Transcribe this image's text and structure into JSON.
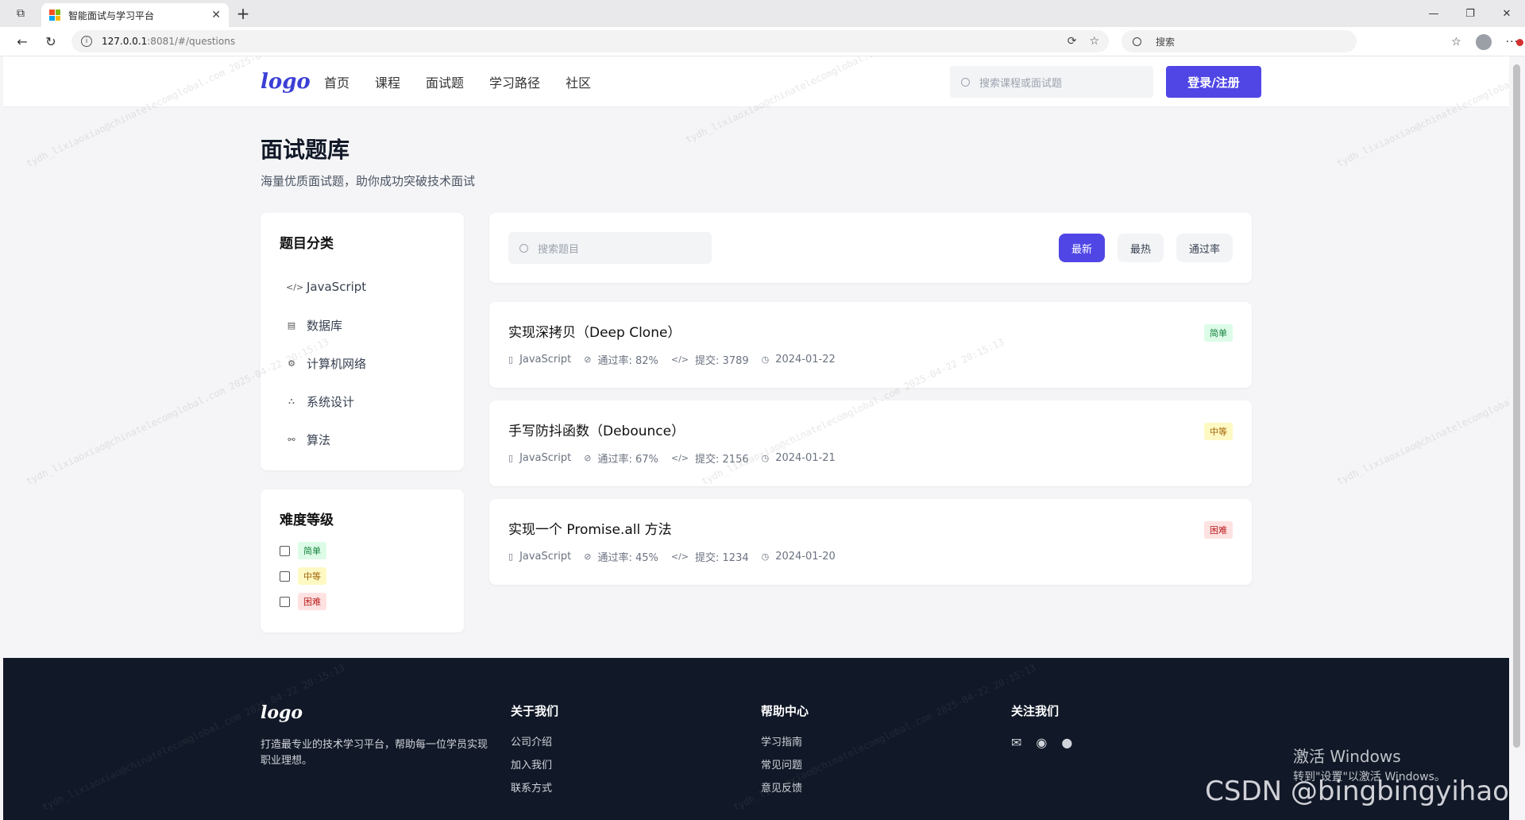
{
  "browser": {
    "tab_title": "智能面试与学习平台",
    "url_host": "127.0.0.1",
    "url_rest": ":8081/#/questions",
    "search_placeholder": "搜索"
  },
  "header": {
    "logo": "logo",
    "nav": [
      "首页",
      "课程",
      "面试题",
      "学习路径",
      "社区"
    ],
    "search_placeholder": "搜索课程或面试题",
    "login_label": "登录/注册"
  },
  "page": {
    "title": "面试题库",
    "subtitle": "海量优质面试题，助你成功突破技术面试"
  },
  "categories": {
    "title": "题目分类",
    "items": [
      {
        "label": "JavaScript",
        "icon": "code-icon"
      },
      {
        "label": "数据库",
        "icon": "database-icon"
      },
      {
        "label": "计算机网络",
        "icon": "network-icon"
      },
      {
        "label": "系统设计",
        "icon": "sitemap-icon"
      },
      {
        "label": "算法",
        "icon": "algorithm-icon"
      }
    ]
  },
  "difficulty": {
    "title": "难度等级",
    "levels": [
      "简单",
      "中等",
      "困难"
    ]
  },
  "filter": {
    "search_placeholder": "搜索题目",
    "sorts": [
      "最新",
      "最热",
      "通过率"
    ],
    "active_sort": "最新"
  },
  "questions": [
    {
      "title": "实现深拷贝（Deep Clone）",
      "category": "JavaScript",
      "pass_rate": "通过率: 82%",
      "submissions": "提交: 3789",
      "date": "2024-01-22",
      "difficulty": "简单"
    },
    {
      "title": "手写防抖函数（Debounce）",
      "category": "JavaScript",
      "pass_rate": "通过率: 67%",
      "submissions": "提交: 2156",
      "date": "2024-01-21",
      "difficulty": "中等"
    },
    {
      "title": "实现一个 Promise.all 方法",
      "category": "JavaScript",
      "pass_rate": "通过率: 45%",
      "submissions": "提交: 1234",
      "date": "2024-01-20",
      "difficulty": "困难"
    }
  ],
  "footer": {
    "logo": "logo",
    "description": "打造最专业的技术学习平台，帮助每一位学员实现职业理想。",
    "about": {
      "title": "关于我们",
      "links": [
        "公司介绍",
        "加入我们",
        "联系方式"
      ]
    },
    "help": {
      "title": "帮助中心",
      "links": [
        "学习指南",
        "常见问题",
        "意见反馈"
      ]
    },
    "follow": {
      "title": "关注我们",
      "icons": [
        "wechat-icon",
        "weibo-icon",
        "github-icon"
      ]
    }
  },
  "overlay": {
    "activate_title": "激活 Windows",
    "activate_sub": "转到\"设置\"以激活 Windows。",
    "csdn": "CSDN @bingbingyihao",
    "watermark": "tydh_lixiaoxiao@chinatelecomglobal.com 2025-04-22 20:15:13"
  },
  "colors": {
    "accent": "#4f46e5",
    "footer_bg": "#111827",
    "easy": "#dcfce7",
    "mid": "#fef9c3",
    "hard": "#fee2e2"
  }
}
